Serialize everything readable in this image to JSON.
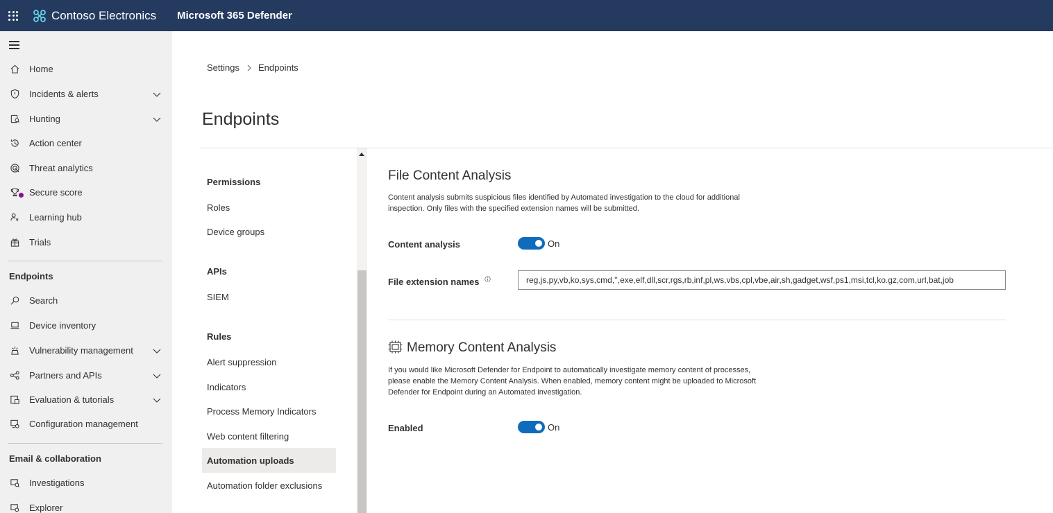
{
  "topbar": {
    "org_name": "Contoso Electronics",
    "product_name": "Microsoft 365 Defender",
    "icons": [
      "app-launcher-icon",
      "contoso-logo-icon"
    ]
  },
  "leftnav": {
    "items": [
      {
        "label": "Home",
        "icon": "home-icon"
      },
      {
        "label": "Incidents & alerts",
        "icon": "shield-icon",
        "expandable": true
      },
      {
        "label": "Hunting",
        "icon": "hunting-icon",
        "expandable": true
      },
      {
        "label": "Action center",
        "icon": "action-center-icon"
      },
      {
        "label": "Threat analytics",
        "icon": "threat-analytics-icon",
        "badge_color": "#8a0e8a"
      },
      {
        "label": "Secure score",
        "icon": "trophy-icon"
      },
      {
        "label": "Learning hub",
        "icon": "learning-hub-icon"
      },
      {
        "label": "Trials",
        "icon": "gift-icon"
      }
    ],
    "sections": [
      {
        "title": "Endpoints",
        "items": [
          {
            "label": "Search",
            "icon": "search-icon"
          },
          {
            "label": "Device inventory",
            "icon": "laptop-icon"
          },
          {
            "label": "Vulnerability management",
            "icon": "vulnerability-icon",
            "expandable": true
          },
          {
            "label": "Partners and APIs",
            "icon": "partners-icon",
            "expandable": true
          },
          {
            "label": "Evaluation & tutorials",
            "icon": "evaluation-icon",
            "expandable": true
          },
          {
            "label": "Configuration management",
            "icon": "configuration-icon"
          }
        ]
      },
      {
        "title": "Email & collaboration",
        "items": [
          {
            "label": "Investigations",
            "icon": "investigations-icon"
          },
          {
            "label": "Explorer",
            "icon": "explorer-icon"
          }
        ]
      }
    ]
  },
  "breadcrumb": {
    "parent": "Settings",
    "current": "Endpoints"
  },
  "page_title": "Endpoints",
  "subnav": {
    "groups": [
      {
        "title": "Permissions",
        "items": [
          "Roles",
          "Device groups"
        ]
      },
      {
        "title": "APIs",
        "items": [
          "SIEM"
        ]
      },
      {
        "title": "Rules",
        "items": [
          "Alert suppression",
          "Indicators",
          "Process Memory Indicators",
          "Web content filtering",
          "Automation uploads",
          "Automation folder exclusions"
        ]
      }
    ],
    "active_item": "Automation uploads"
  },
  "file_content_analysis": {
    "title": "File Content Analysis",
    "description": "Content analysis submits suspicious files identified by Automated investigation to the cloud for additional inspection. Only files with the specified extension names will be submitted.",
    "toggle_label": "Content analysis",
    "toggle_state": "On",
    "ext_label": "File extension names",
    "ext_value": "reg,js,py,vb,ko,sys,cmd,'',exe,elf,dll,scr,rgs,rb,inf,pl,ws,vbs,cpl,vbe,air,sh,gadget,wsf,ps1,msi,tcl,ko.gz,com,url,bat,job"
  },
  "memory_content_analysis": {
    "title": "Memory Content Analysis",
    "description": "If you would like Microsoft Defender for Endpoint to automatically investigate memory content of processes, please enable the Memory Content Analysis. When enabled, memory content might be uploaded to Microsoft Defender for Endpoint during an Automated investigation.",
    "toggle_label": "Enabled",
    "toggle_state": "On"
  },
  "colors": {
    "topbar": "#243a5e",
    "toggle_on": "#0f6cbd",
    "nav_bg": "#f0f0f0"
  }
}
